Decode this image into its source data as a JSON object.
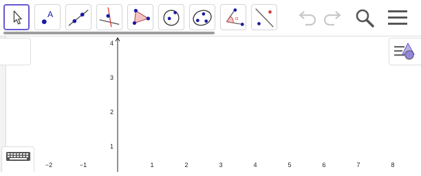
{
  "toolbar": {
    "tools": [
      {
        "name": "move-tool",
        "icon": "cursor-arrow-icon",
        "active": true
      },
      {
        "name": "point-tool",
        "icon": "point-label-icon",
        "label": "A"
      },
      {
        "name": "line-tool",
        "icon": "line-through-points-icon"
      },
      {
        "name": "perpendicular-line-tool",
        "icon": "perpendicular-line-icon"
      },
      {
        "name": "polygon-tool",
        "icon": "polygon-icon"
      },
      {
        "name": "circle-tool",
        "icon": "circle-center-point-icon"
      },
      {
        "name": "conic-tool",
        "icon": "ellipse-icon"
      },
      {
        "name": "angle-tool",
        "icon": "angle-icon",
        "label": "α"
      },
      {
        "name": "reflect-tool",
        "icon": "reflect-about-line-icon"
      }
    ],
    "actions": [
      {
        "name": "undo-button",
        "icon": "undo-icon",
        "enabled": false
      },
      {
        "name": "redo-button",
        "icon": "redo-icon",
        "enabled": false
      },
      {
        "name": "search-button",
        "icon": "search-icon",
        "enabled": true
      },
      {
        "name": "menu-button",
        "icon": "hamburger-menu-icon",
        "enabled": true
      }
    ]
  },
  "graphics": {
    "x_axis": {
      "min": -2,
      "max": 8,
      "ticks": [
        -2,
        -1,
        1,
        2,
        3,
        4,
        5,
        6,
        7,
        8
      ]
    },
    "y_axis": {
      "ticks": [
        1,
        2,
        3,
        4
      ]
    }
  },
  "style_bar": {
    "icon": "style-bar-toggle-icon"
  },
  "keyboard": {
    "icon": "keyboard-icon"
  },
  "colors": {
    "accent": "#6557d2",
    "point": "#1a1aa6",
    "polygon_fill": "#f2c4c4",
    "polygon_stroke": "#c0504d",
    "disabled": "#c8c8c8",
    "icon": "#555555"
  }
}
